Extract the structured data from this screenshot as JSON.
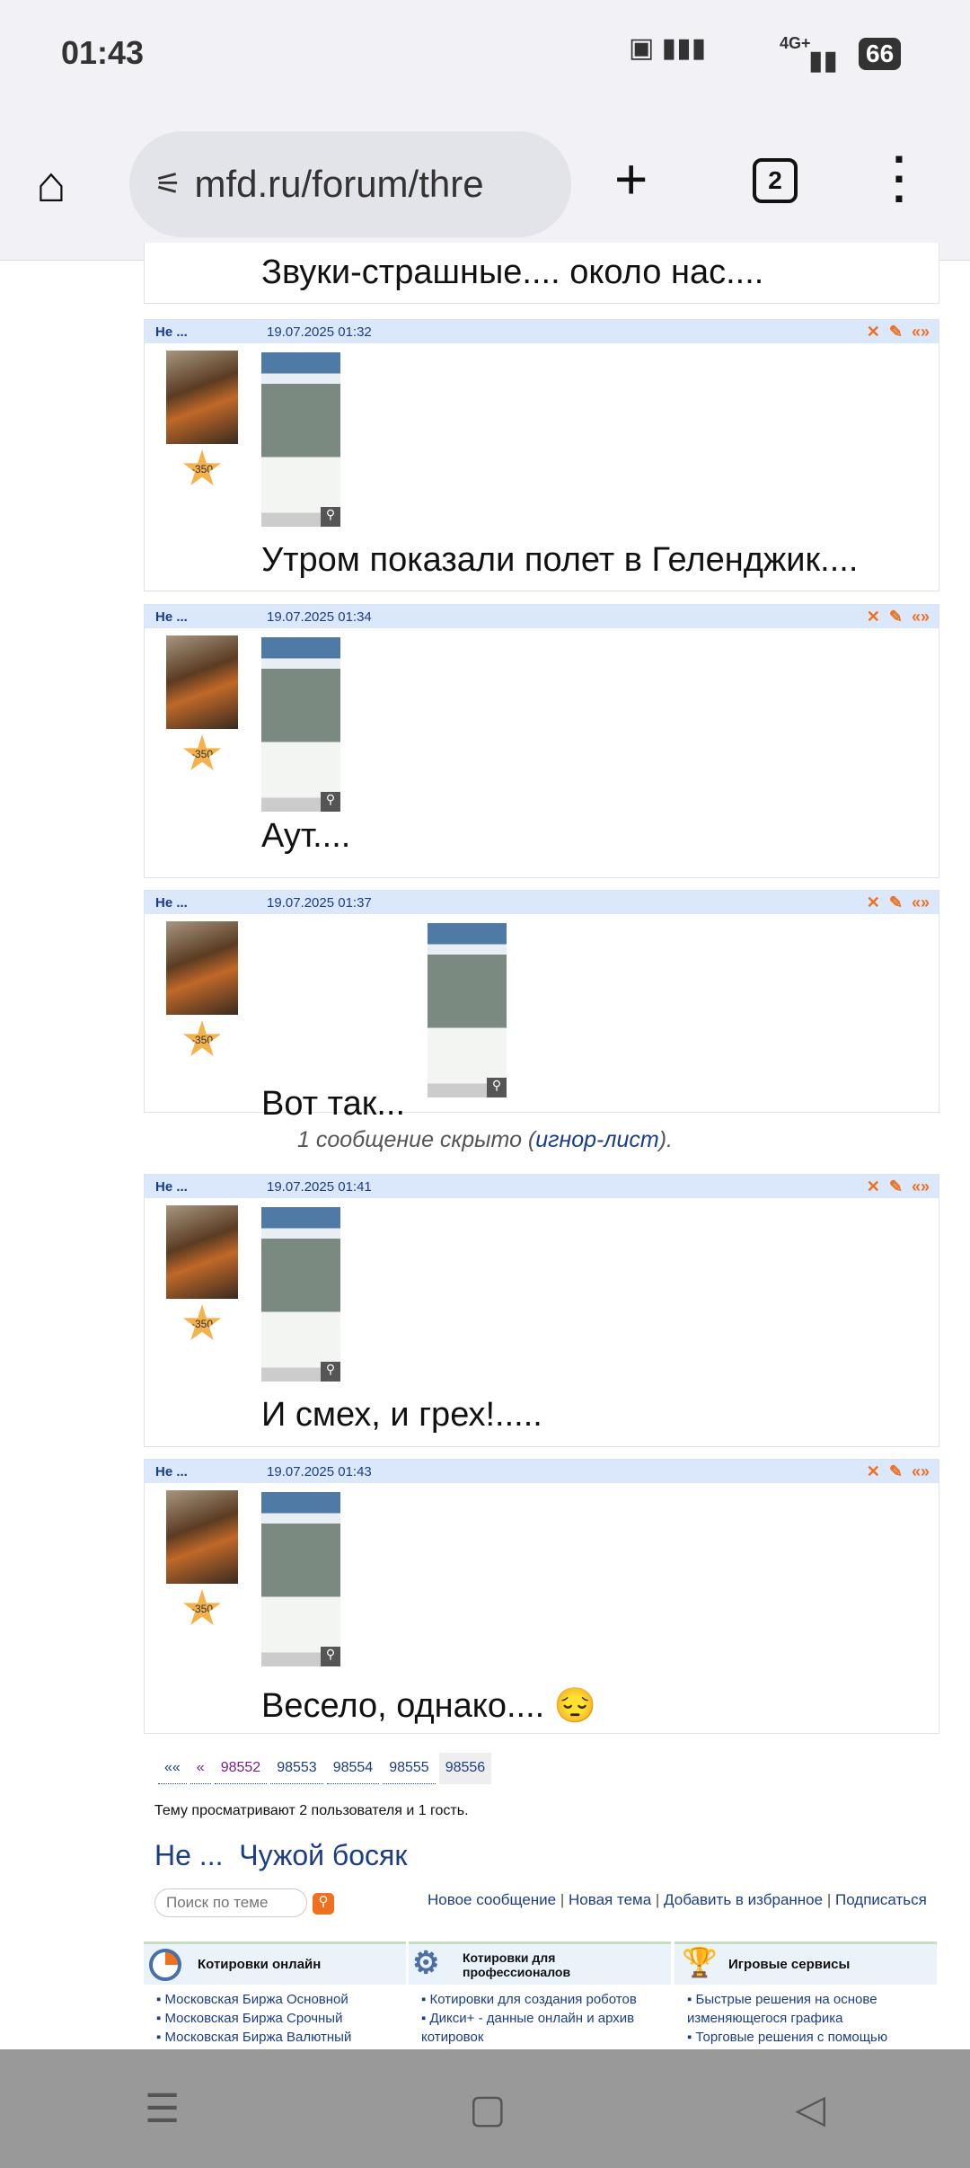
{
  "status": {
    "time": "01:43",
    "battery": "66",
    "network": "4G+"
  },
  "browser": {
    "url": "mfd.ru/forum/thre",
    "tabs_count": "2"
  },
  "top_partial_post": {
    "text": "Звуки-страшные.... около нас...."
  },
  "posts": [
    {
      "author": "Не ...",
      "date": "19.07.2025 01:32",
      "rating": "-350",
      "text": "Утром показали полет в Геленджик...."
    },
    {
      "author": "Не ...",
      "date": "19.07.2025 01:34",
      "rating": "-350",
      "text": "Аут...."
    },
    {
      "author": "Не ...",
      "date": "19.07.2025 01:37",
      "rating": "-350",
      "text": "Вот так..."
    },
    {
      "author": "Не ...",
      "date": "19.07.2025 01:41",
      "rating": "-350",
      "text": "И смех, и грех!....."
    },
    {
      "author": "Не ...",
      "date": "19.07.2025 01:43",
      "rating": "-350",
      "text": "Весело, однако.... 😔"
    }
  ],
  "hidden": {
    "prefix": "1 сообщение скрыто (",
    "link": "игнор-лист",
    "suffix": ")."
  },
  "pagination": [
    "««",
    "«",
    "98552",
    "98553",
    "98554",
    "98555",
    "98556"
  ],
  "viewers": "Тему просматривают 2 пользователя и 1 гость.",
  "title": {
    "author": "Не ...",
    "topic": "Чужой босяк"
  },
  "search": {
    "placeholder": "Поиск по теме"
  },
  "actions": [
    "Новое сообщение",
    "Новая тема",
    "Добавить в избранное",
    "Подписаться"
  ],
  "boxes": [
    {
      "title": "Котировки онлайн",
      "items": [
        "Московская Биржа Основной",
        "Московская Биржа Срочный",
        "Московская Биржа Валютный"
      ]
    },
    {
      "title": "Котировки для профессионалов",
      "items": [
        "Котировки для создания роботов",
        "Дикси+ - данные онлайн и архив котировок"
      ]
    },
    {
      "title": "Игровые сервисы",
      "items": [
        "Быстрые решения на основе изменяющегося графика",
        "Торговые решения с помощью"
      ]
    }
  ]
}
